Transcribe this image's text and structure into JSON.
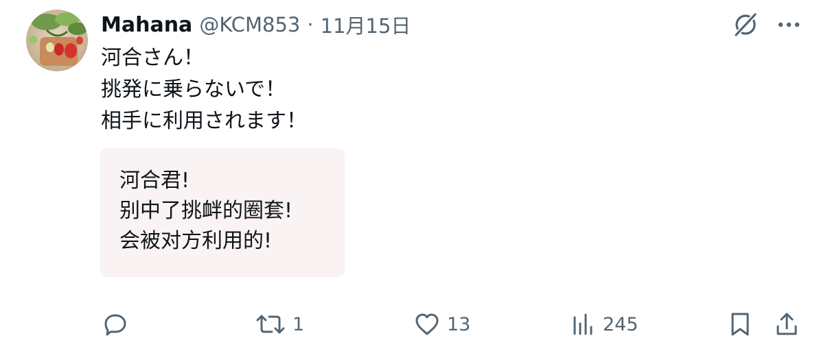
{
  "tweet": {
    "author": {
      "display_name": "Mahana",
      "handle": "@KCM853",
      "separator": "·",
      "date": "11月15日",
      "avatar_icon": "strawberry-photo-avatar"
    },
    "text_lines": [
      "河合さん！",
      "挑発に乗らないで！",
      "相手に利用されます！"
    ],
    "translation_card": {
      "lines": [
        "河合君!",
        "别中了挑衅的圈套!",
        "会被对方利用的!"
      ],
      "background": "#f9f3f3"
    },
    "actions": {
      "reply_icon": "reply-icon",
      "retweet_count": "1",
      "like_count": "13",
      "views_count": "245",
      "bookmark_icon": "bookmark-icon",
      "share_icon": "share-icon"
    },
    "header_icons": [
      "grok-icon",
      "more-icon"
    ]
  },
  "colors": {
    "text_primary": "#0f1419",
    "text_secondary": "#536471",
    "card_bg": "#f9f3f3"
  }
}
